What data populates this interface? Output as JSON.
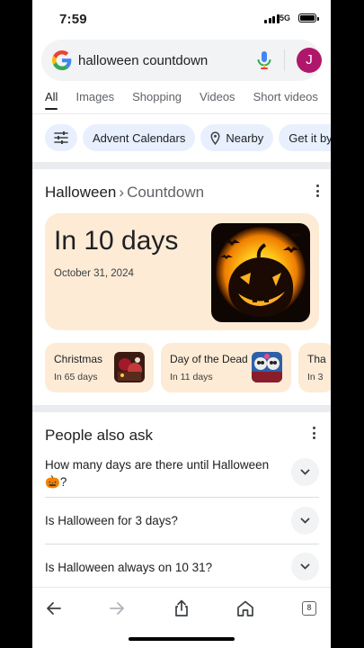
{
  "status_bar": {
    "time": "7:59",
    "network": "5G"
  },
  "search": {
    "query": "halloween countdown",
    "avatar_initial": "J"
  },
  "tabs": [
    "All",
    "Images",
    "Shopping",
    "Videos",
    "Short videos"
  ],
  "chips": [
    "Advent Calendars",
    "Nearby",
    "Get it by T"
  ],
  "countdown": {
    "breadcrumb_1": "Halloween",
    "breadcrumb_sep": "›",
    "breadcrumb_2": "Countdown",
    "headline": "In 10 days",
    "date": "October 31, 2024"
  },
  "related": [
    {
      "title": "Christmas",
      "subtitle": "In 65 days"
    },
    {
      "title": "Day of the Dead",
      "subtitle": "In 11 days"
    },
    {
      "title": "Tha",
      "subtitle": "In 3"
    }
  ],
  "people_also_ask": {
    "title": "People also ask",
    "questions": [
      {
        "line1": "How many days are there until Halloween",
        "line2": "?",
        "emoji": "🎃"
      },
      {
        "line1": "Is Halloween for 3 days?"
      },
      {
        "line1": "Is Halloween always on 10 31?"
      }
    ]
  },
  "bottom_nav": {
    "tab_count": "8"
  },
  "colors": {
    "card_bg": "#fdebd5",
    "chip_bg": "#e8f0fe",
    "avatar_bg": "#b0176a"
  },
  "icons": [
    "google-g-icon",
    "mic-icon",
    "tune-icon",
    "location-pin-icon",
    "more-vert-icon",
    "expand-more-icon",
    "back-icon",
    "forward-icon",
    "share-icon",
    "home-icon",
    "tabs-icon"
  ]
}
